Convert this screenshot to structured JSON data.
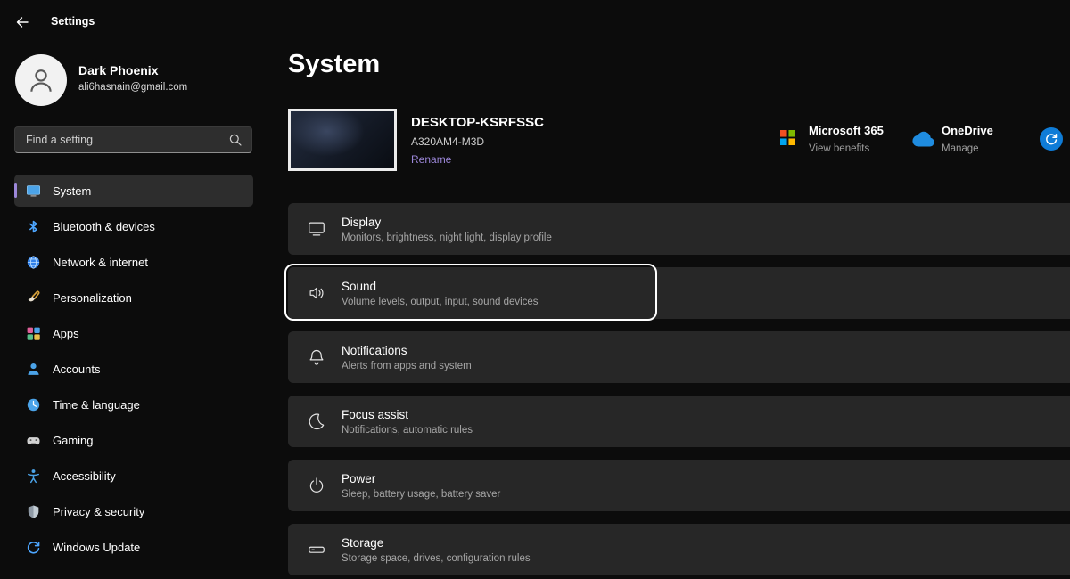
{
  "titlebar": {
    "app_title": "Settings"
  },
  "sidebar": {
    "user": {
      "name": "Dark Phoenix",
      "email": "ali6hasnain@gmail.com"
    },
    "search": {
      "placeholder": "Find a setting"
    },
    "items": [
      {
        "label": "System",
        "icon": "system-icon",
        "selected": true
      },
      {
        "label": "Bluetooth & devices",
        "icon": "bluetooth-icon"
      },
      {
        "label": "Network & internet",
        "icon": "network-icon"
      },
      {
        "label": "Personalization",
        "icon": "personalization-icon"
      },
      {
        "label": "Apps",
        "icon": "apps-icon"
      },
      {
        "label": "Accounts",
        "icon": "accounts-icon"
      },
      {
        "label": "Time & language",
        "icon": "time-language-icon"
      },
      {
        "label": "Gaming",
        "icon": "gaming-icon"
      },
      {
        "label": "Accessibility",
        "icon": "accessibility-icon"
      },
      {
        "label": "Privacy & security",
        "icon": "privacy-security-icon"
      },
      {
        "label": "Windows Update",
        "icon": "windows-update-icon"
      }
    ]
  },
  "main": {
    "page_title": "System",
    "device": {
      "name": "DESKTOP-KSRFSSC",
      "model": "A320AM4-M3D",
      "rename_label": "Rename"
    },
    "account_links": [
      {
        "title": "Microsoft 365",
        "subtitle": "View benefits",
        "icon": "microsoft-365-icon"
      },
      {
        "title": "OneDrive",
        "subtitle": "Manage",
        "icon": "onedrive-icon"
      }
    ],
    "sync_icon": "sync-icon",
    "rows": [
      {
        "title": "Display",
        "subtitle": "Monitors, brightness, night light, display profile",
        "icon": "display-icon"
      },
      {
        "title": "Sound",
        "subtitle": "Volume levels, output, input, sound devices",
        "icon": "sound-icon",
        "focused": true
      },
      {
        "title": "Notifications",
        "subtitle": "Alerts from apps and system",
        "icon": "notifications-icon"
      },
      {
        "title": "Focus assist",
        "subtitle": "Notifications, automatic rules",
        "icon": "focus-assist-icon"
      },
      {
        "title": "Power",
        "subtitle": "Sleep, battery usage, battery saver",
        "icon": "power-icon"
      },
      {
        "title": "Storage",
        "subtitle": "Storage space, drives, configuration rules",
        "icon": "storage-icon"
      }
    ]
  },
  "colors": {
    "accent": "#9c87d9",
    "card": "#272727",
    "page_bg": "#0c0c0c",
    "sync_blue": "#0f7cd7"
  }
}
